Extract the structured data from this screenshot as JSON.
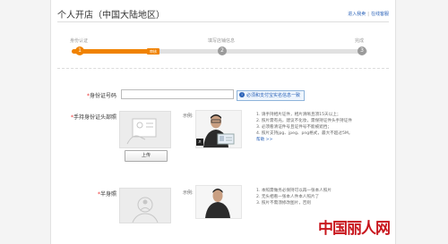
{
  "header": {
    "title": "个人开店（中国大陆地区）",
    "links": [
      "进入我卖",
      "在线客服"
    ],
    "link_sep": "|"
  },
  "steps": {
    "labels": [
      "身份认证",
      "填写店铺信息",
      "完成"
    ],
    "numbers": [
      "1",
      "2",
      "3"
    ],
    "current_tag": "审核",
    "progress_fraction": 0.29,
    "accent_color": "#f08200"
  },
  "form": {
    "id_label": "身份证号码",
    "id_value": "",
    "notice_text": "必须和支付宝实名信息一致",
    "hold_id_label": "手持身份证头部照",
    "upload_label": "上传",
    "example_label": "示例:",
    "hold_id_tips": [
      "1. 请手持相片证件，相片清晰且须15天以上；",
      "2. 照片需有光，建议不化妆，需保持证件头手持证件",
      "3. 必须看清证件号且证件号不能被遮挡；",
      "4. 照片支持jpg、jpeg、png格式，最大不超过5M。"
    ],
    "more_link": "帮助 >>",
    "half_label": "半身照",
    "half_tips": [
      "1. 本照需做务必保持可以再一张本人照片",
      "2. 无头相看一张本人件本人照片了",
      "3. 照片不需须修改图片，否则"
    ]
  },
  "watermark": "中国丽人网"
}
